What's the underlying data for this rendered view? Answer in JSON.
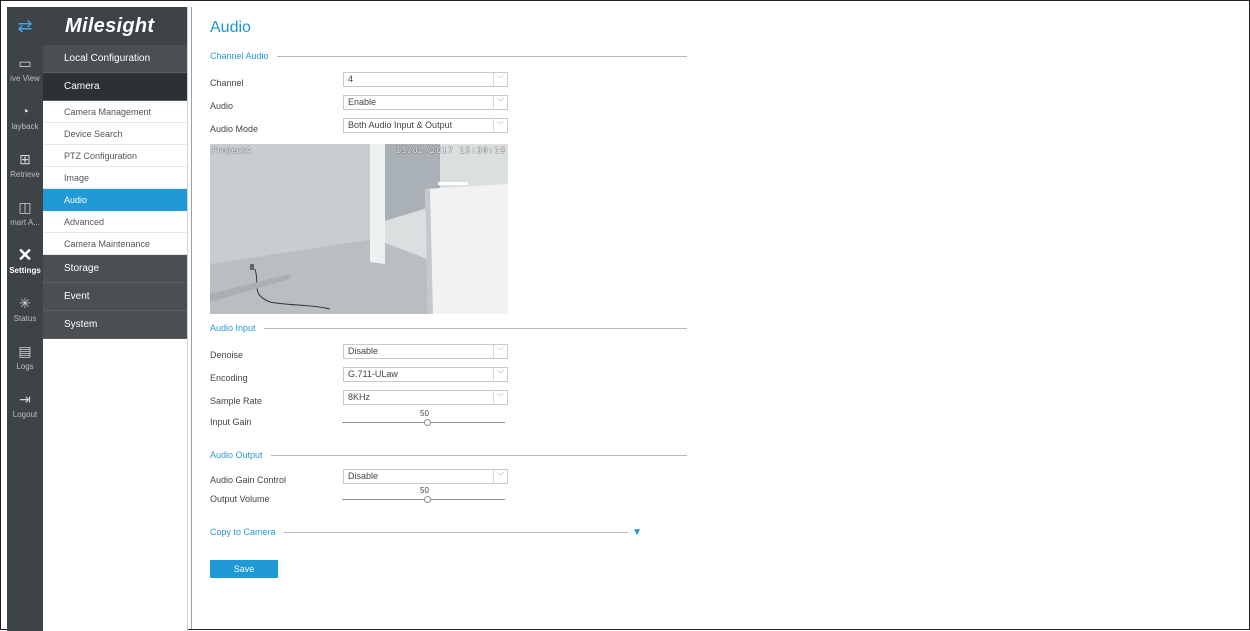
{
  "brand": {
    "logo_text": "Milesight",
    "accent": "#1f9ad6"
  },
  "rail": {
    "items": [
      {
        "label": "ive View",
        "icon": "live-view-icon"
      },
      {
        "label": "layback",
        "icon": "playback-icon"
      },
      {
        "label": "Retrieve",
        "icon": "retrieve-icon"
      },
      {
        "label": "mart A...",
        "icon": "smart-analysis-icon"
      },
      {
        "label": "Settings",
        "icon": "settings-icon"
      },
      {
        "label": "Status",
        "icon": "status-icon"
      },
      {
        "label": "Logs",
        "icon": "logs-icon"
      },
      {
        "label": "Logout",
        "icon": "logout-icon"
      }
    ]
  },
  "menu": {
    "local": "Local Configuration",
    "camera": "Camera",
    "subitems": [
      "Camera Management",
      "Device Search",
      "PTZ Configuration",
      "Image",
      "Audio",
      "Advanced",
      "Camera Maintenance"
    ],
    "storage": "Storage",
    "event": "Event",
    "system": "System"
  },
  "page": {
    "title": "Audio",
    "channel_audio_section": "Channel Audio",
    "channel": {
      "label": "Channel",
      "value": "4"
    },
    "audio": {
      "label": "Audio",
      "value": "Enable"
    },
    "audio_mode": {
      "label": "Audio Mode",
      "value": "Both Audio Input & Output"
    },
    "preview": {
      "name_overlay": "ProjectA",
      "time_overlay": "13/02/2017 15:30:19"
    },
    "audio_input_section": "Audio Input",
    "denoise": {
      "label": "Denoise",
      "value": "Disable"
    },
    "encoding": {
      "label": "Encoding",
      "value": "G.711-ULaw"
    },
    "sample_rate": {
      "label": "Sample Rate",
      "value": "8KHz"
    },
    "input_gain": {
      "label": "Input Gain",
      "value": "50"
    },
    "audio_output_section": "Audio Output",
    "audio_gain_control": {
      "label": "Audio Gain Control",
      "value": "Disable"
    },
    "output_volume": {
      "label": "Output Volume",
      "value": "50"
    },
    "copy_to_camera": "Copy to Camera",
    "save": "Save"
  }
}
